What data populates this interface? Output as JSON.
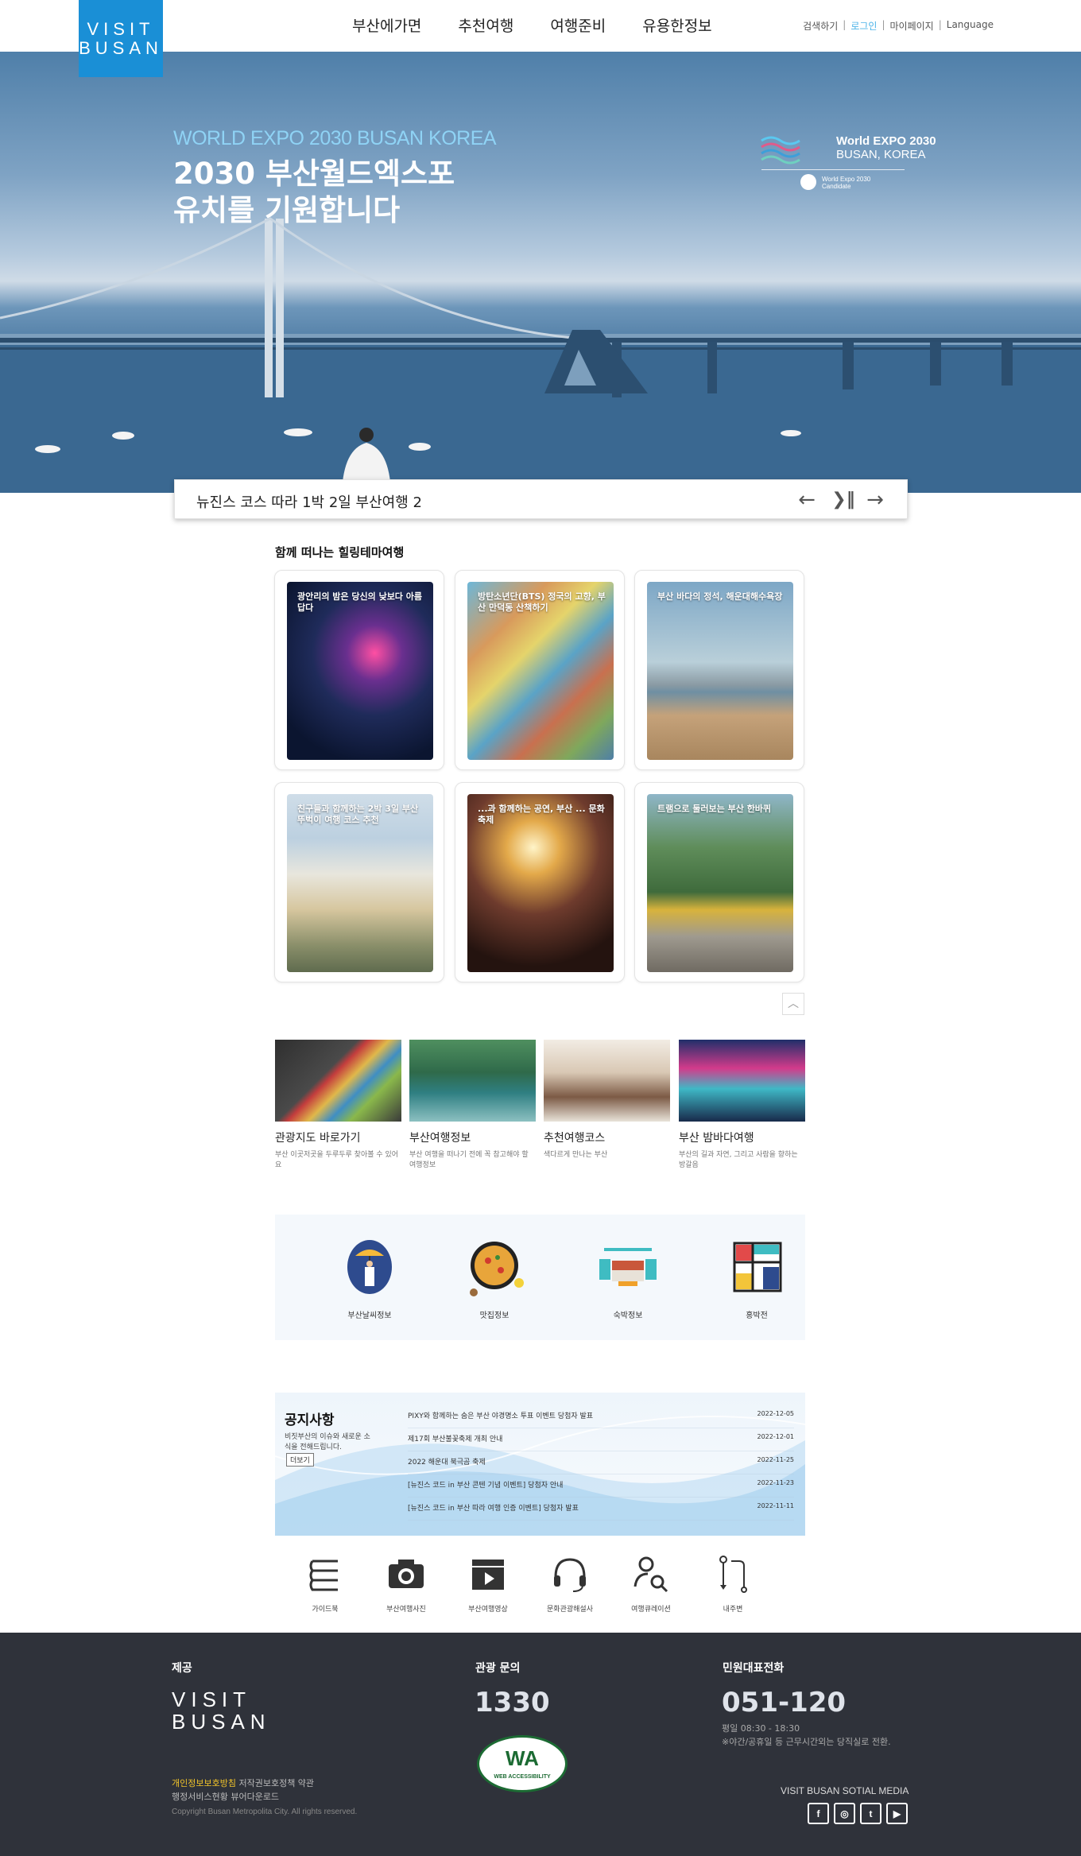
{
  "header": {
    "logo_line1": "VISIT",
    "logo_line2": "BUSAN",
    "nav": [
      "부산에가면",
      "추천여행",
      "여행준비",
      "유용한정보"
    ],
    "util": {
      "search": "검색하기",
      "login": "로그인",
      "mypage": "마이페이지",
      "language": "Language"
    }
  },
  "hero": {
    "eyebrow": "WORLD EXPO 2030 BUSAN KOREA",
    "title_line1": "2030 부산월드엑스포",
    "title_line2": "유치를 기원합니다",
    "expo_logo": {
      "name1": "World EXPO 2030",
      "name2": "BUSAN, KOREA",
      "small1": "World Expo 2030",
      "small2": "Candidate"
    }
  },
  "slidebar": {
    "caption": "뉴진스 코스 따라 1박 2일 부산여행 2"
  },
  "healing": {
    "title": "함께 떠나는 힐링테마여행",
    "cards": [
      {
        "caption": "광안리의 밤은 당신의 낮보다 아름답다"
      },
      {
        "caption": "방탄소년단(BTS) 정국의 고향, 부산 만덕동 산책하기"
      },
      {
        "caption": "부산 바다의 정석, 해운대해수욕장"
      },
      {
        "caption": "친구들과 함께하는 2박 3일 부산 뚜벅이 여행 코스 추천"
      },
      {
        "caption": "...과 함께하는 공연, 부산 ... 문화축제"
      },
      {
        "caption": "트램으로 둘러보는 부산 한바퀴"
      }
    ]
  },
  "thumbs": [
    {
      "title": "관광지도 바로가기",
      "desc": "부산 이곳저곳을 두루두루 찾아볼 수 있어요"
    },
    {
      "title": "부산여행정보",
      "desc": "부산 여행을 떠나기 전에 꼭 참고해야 할 여행정보"
    },
    {
      "title": "추천여행코스",
      "desc": "색다르게 만나는 부산"
    },
    {
      "title": "부산 밤바다여행",
      "desc": "부산의 길과 자연, 그리고 사람을 향하는 방갈음"
    }
  ],
  "info": [
    "부산날씨정보",
    "맛집정보",
    "숙박정보",
    "홍박전"
  ],
  "notice": {
    "title": "공지사항",
    "sub": "비짓부산의 이슈와 새로운 소식을 전해드립니다.",
    "more": "더보기",
    "items": [
      {
        "text": "PIXY와 함께하는 숨은 부산 야경명소 투표 이벤트 당첨자 발표",
        "date": "2022-12-05"
      },
      {
        "text": "제17회 부산불꽃축제 개최 안내",
        "date": "2022-12-01"
      },
      {
        "text": "2022 해운대 북극곰 축제",
        "date": "2022-11-25"
      },
      {
        "text": "[뉴진스 코드 in 부산 콘텐 기념 이벤트] 당첨자 안내",
        "date": "2022-11-23"
      },
      {
        "text": "[뉴진스 코드 in 부산 따라 여행 인증 이벤트] 당첨자 발표",
        "date": "2022-11-11"
      }
    ]
  },
  "quick": [
    "가이드북",
    "부산여행사진",
    "부산여행영상",
    "문화관광해설사",
    "여행큐레이션",
    "내주변"
  ],
  "footer": {
    "provide": "제공",
    "logo_line1": "VISIT",
    "logo_line2": "BUSAN",
    "inquiry_title": "관광 문의",
    "inquiry_number": "1330",
    "rep_title": "민원대표전화",
    "rep_number": "051-120",
    "hours1": "평일 08:30 - 18:30",
    "hours2": "※야간/공휴일 등 근무시간외는 당직실로 전환.",
    "wa_big": "WA",
    "wa_small": "WEB ACCESSIBILITY",
    "privacy": "개인정보보호방침",
    "links1": "저작권보호정책 약관",
    "links2": "행정서비스현황 뷰어다운로드",
    "copyright": "Copyright Busan Metropolita City. All rights reserved.",
    "social_title": "VISIT BUSAN SOTIAL MEDIA",
    "social": [
      "f",
      "◎",
      "t",
      "▶"
    ]
  }
}
